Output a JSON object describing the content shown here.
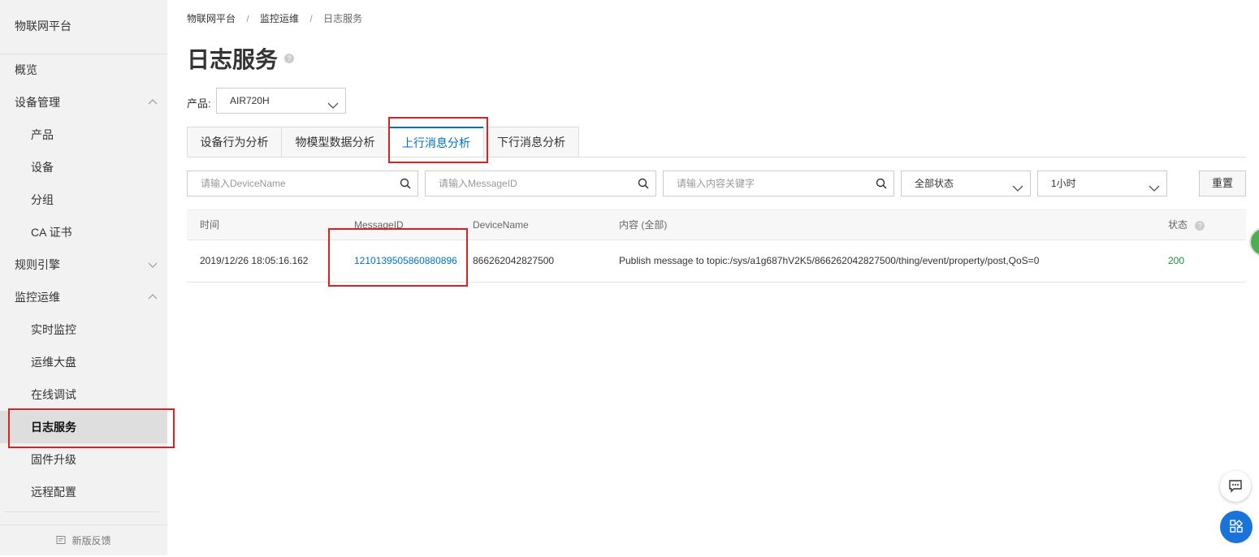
{
  "sidebar": {
    "title": "物联网平台",
    "overview": "概览",
    "device_mgmt": "设备管理",
    "product": "产品",
    "device": "设备",
    "group": "分组",
    "ca_cert": "CA 证书",
    "rule_engine": "规则引擎",
    "monitoring": "监控运维",
    "realtime": "实时监控",
    "dashboard": "运维大盘",
    "online_debug": "在线调试",
    "log_service": "日志服务",
    "firmware": "固件升级",
    "remote_config": "远程配置",
    "feedback": "新版反馈"
  },
  "breadcrumb": {
    "root": "物联网平台",
    "mid": "监控运维",
    "current": "日志服务",
    "sep": "/"
  },
  "page": {
    "title": "日志服务",
    "help": "?"
  },
  "product_filter": {
    "label": "产品:",
    "value": "AIR720H"
  },
  "tabs": [
    "设备行为分析",
    "物模型数据分析",
    "上行消息分析",
    "下行消息分析"
  ],
  "filters": {
    "device_name_placeholder": "请输入DeviceName",
    "message_id_placeholder": "请输入MessageID",
    "content_placeholder": "请输入内容关键字",
    "status_value": "全部状态",
    "time_value": "1小时",
    "reset_label": "重置"
  },
  "table": {
    "headers": {
      "time": "时间",
      "message_id": "MessageID",
      "device_name": "DeviceName",
      "content": "内容 (全部)",
      "status": "状态"
    },
    "rows": [
      {
        "time": "2019/12/26 18:05:16.162",
        "message_id": "1210139505860880896",
        "device_name": "866262042827500",
        "content": "Publish message to topic:/sys/a1g687hV2K5/866262042827500/thing/event/property/post,QoS=0",
        "status": "200"
      }
    ]
  },
  "colors": {
    "accent": "#0070cc",
    "highlight": "#e02020",
    "status_ok": "#1e8e3e"
  },
  "icons": {
    "chat": "chat-icon",
    "apps": "apps-icon"
  }
}
